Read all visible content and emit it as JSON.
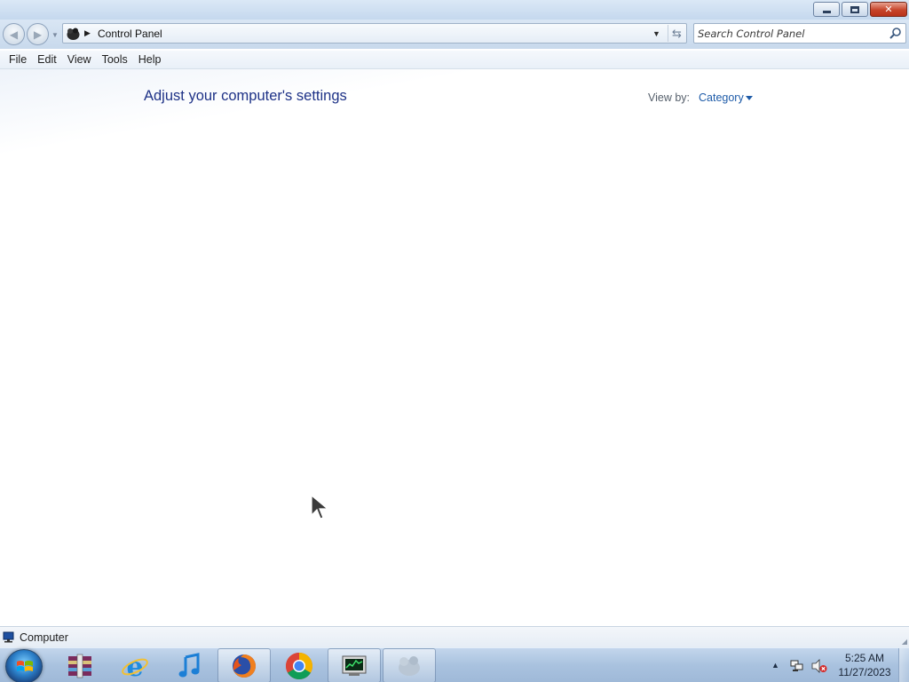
{
  "window": {
    "address": {
      "path": "Control Panel"
    },
    "search": {
      "placeholder": "Search Control Panel"
    },
    "menu": [
      "File",
      "Edit",
      "View",
      "Tools",
      "Help"
    ]
  },
  "content": {
    "title": "Adjust your computer's settings",
    "view_by_label": "View by:",
    "view_by_value": "Category"
  },
  "statusbar": {
    "text": "Computer"
  },
  "taskbar": {
    "apps": [
      {
        "name": "winrar-icon",
        "active": false
      },
      {
        "name": "internet-explorer-icon",
        "active": false
      },
      {
        "name": "itunes-icon",
        "active": false
      },
      {
        "name": "firefox-icon",
        "active": true
      },
      {
        "name": "chrome-icon",
        "active": false
      },
      {
        "name": "task-manager-icon",
        "active": true
      },
      {
        "name": "control-panel-icon",
        "active": true
      }
    ],
    "clock": {
      "time": "5:25 AM",
      "date": "11/27/2023"
    }
  },
  "colors": {
    "title_blue": "#1e3287",
    "link_blue": "#1e5ba8",
    "taskbar": "#a9c2df"
  }
}
